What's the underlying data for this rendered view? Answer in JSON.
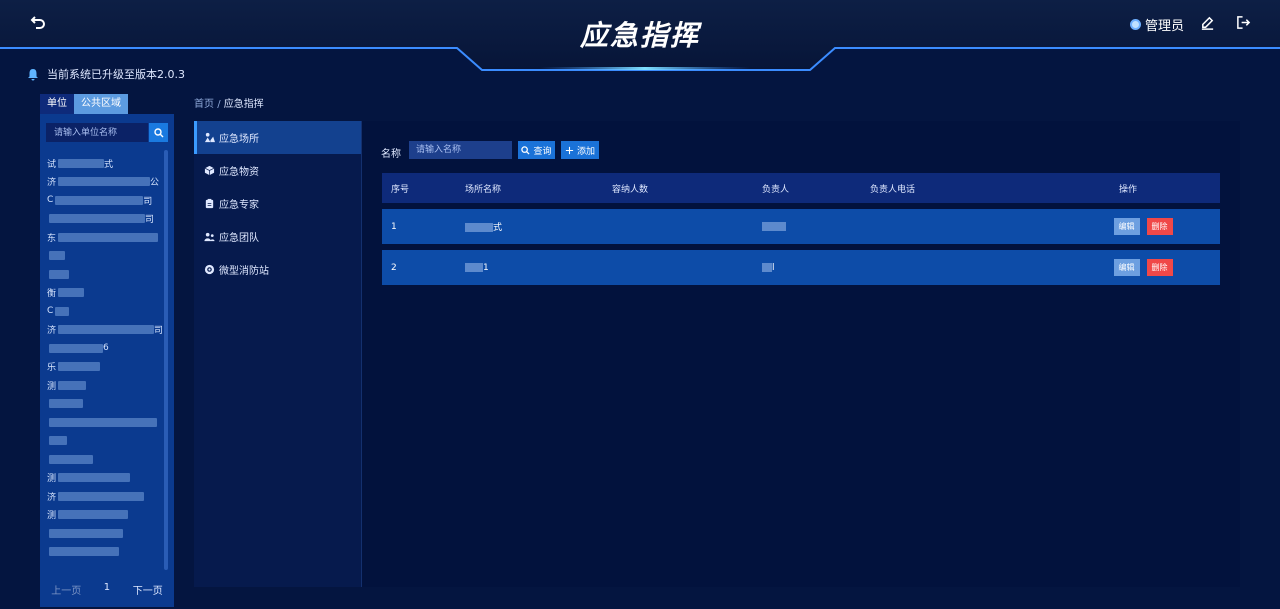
{
  "header": {
    "title": "应急指挥",
    "user_label": "管理员",
    "back_icon": "back-arrow-icon",
    "edit_icon": "edit-icon",
    "logout_icon": "logout-icon",
    "accent": "#3b8cff"
  },
  "notice": {
    "text": "当前系统已升级至版本2.0.3"
  },
  "left_panel": {
    "tabs": [
      {
        "label": "单位",
        "active": true
      },
      {
        "label": "公共区域",
        "active": false
      }
    ],
    "search_placeholder": "请输入单位名称",
    "units": [
      {
        "prefix": "试",
        "suffix": "式"
      },
      {
        "prefix": "济",
        "suffix": "公"
      },
      {
        "prefix": "C",
        "suffix": "司"
      },
      {
        "prefix": "",
        "suffix": "司"
      },
      {
        "prefix": "东",
        "suffix": ""
      },
      {
        "prefix": "",
        "suffix": ""
      },
      {
        "prefix": "",
        "suffix": ""
      },
      {
        "prefix": "衡",
        "suffix": ""
      },
      {
        "prefix": "C",
        "suffix": ""
      },
      {
        "prefix": "济",
        "suffix": "司"
      },
      {
        "prefix": "",
        "suffix": "6"
      },
      {
        "prefix": "乐",
        "suffix": ""
      },
      {
        "prefix": "测",
        "suffix": ""
      },
      {
        "prefix": "",
        "suffix": ""
      },
      {
        "prefix": "",
        "suffix": ""
      },
      {
        "prefix": "",
        "suffix": ""
      },
      {
        "prefix": "",
        "suffix": ""
      },
      {
        "prefix": "测",
        "suffix": ""
      },
      {
        "prefix": "济",
        "suffix": ""
      },
      {
        "prefix": "测",
        "suffix": ""
      },
      {
        "prefix": "",
        "suffix": ""
      },
      {
        "prefix": "",
        "suffix": ""
      }
    ],
    "pager": {
      "prev": "上一页",
      "page": "1",
      "next": "下一页"
    }
  },
  "breadcrumb": {
    "home": "首页",
    "sep": "/",
    "current": "应急指挥"
  },
  "menu": [
    {
      "label": "应急场所",
      "icon": "place-icon",
      "active": true
    },
    {
      "label": "应急物资",
      "icon": "box-icon",
      "active": false
    },
    {
      "label": "应急专家",
      "icon": "expert-icon",
      "active": false
    },
    {
      "label": "应急团队",
      "icon": "team-icon",
      "active": false
    },
    {
      "label": "微型消防站",
      "icon": "fire-station-icon",
      "active": false
    }
  ],
  "filter": {
    "label": "名称",
    "placeholder": "请输入名称",
    "query_label": "查询",
    "add_label": "添加"
  },
  "table": {
    "columns": [
      "序号",
      "场所名称",
      "容纳人数",
      "负责人",
      "负责人电话",
      "操作"
    ],
    "rows": [
      {
        "index": "1",
        "name": "式",
        "capacity": "",
        "person": "",
        "phone": ""
      },
      {
        "index": "2",
        "name": "1",
        "capacity": "",
        "person": "l",
        "phone": ""
      }
    ],
    "edit_label": "编辑",
    "delete_label": "删除"
  }
}
